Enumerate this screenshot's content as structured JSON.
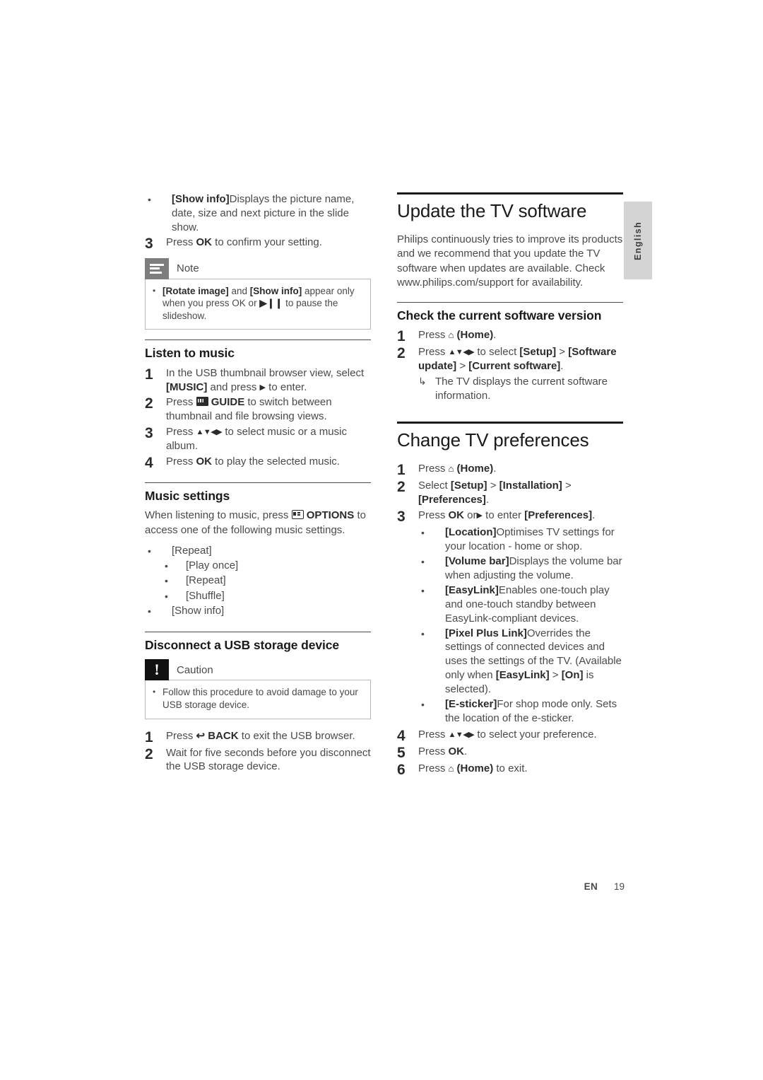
{
  "page": {
    "language_tab": "English",
    "footer_locale": "EN",
    "footer_page": "19"
  },
  "left_column": {
    "top_bullet": {
      "marker": "•",
      "label": "[Show info]",
      "text": "Displays the picture name, date, size and next picture in the slide show."
    },
    "step3": {
      "num": "3",
      "pre": "Press ",
      "key": "OK",
      "post": " to confirm your setting."
    },
    "note_box": {
      "icon": "note-lines-icon",
      "title": "Note",
      "bullet_marker": "•",
      "text_part1": "[Rotate image]",
      "text_part2": " and ",
      "text_part3": "[Show info]",
      "text_part4": " appear only when you press OK or ",
      "text_part5": "▶❙❙",
      "text_part6": " to pause the slideshow."
    },
    "listen_to_music": {
      "heading": "Listen to music",
      "steps": [
        {
          "num": "1",
          "pre": "In the USB thumbnail browser view, select ",
          "bold": "[MUSIC]",
          "mid": " and press ",
          "glyph": "▶",
          "post": " to enter."
        },
        {
          "num": "2",
          "pre": "Press ",
          "icon": "guide-key-icon",
          "bold": "GUIDE",
          "post": " to switch between thumbnail and file browsing views."
        },
        {
          "num": "3",
          "pre": "Press ",
          "arrows": "▲▼◀▶",
          "post": " to select music or a music album."
        },
        {
          "num": "4",
          "pre": "Press ",
          "bold": "OK",
          "post": " to play the selected music."
        }
      ]
    },
    "music_settings": {
      "heading": "Music settings",
      "intro_pre": "When listening to music, press ",
      "intro_icon": "options-key-icon",
      "intro_bold": "OPTIONS",
      "intro_post": " to access one of the following music settings.",
      "items": [
        {
          "marker": "•",
          "label": "[Repeat]",
          "level": 1
        },
        {
          "marker": "•",
          "label": "[Play once]",
          "level": 2
        },
        {
          "marker": "•",
          "label": "[Repeat]",
          "level": 2
        },
        {
          "marker": "•",
          "label": "[Shuffle]",
          "level": 2
        },
        {
          "marker": "•",
          "label": "[Show info]",
          "level": 1
        }
      ]
    },
    "disconnect_usb": {
      "heading": "Disconnect a USB storage device",
      "caution_box": {
        "icon": "exclamation-icon",
        "title": "Caution",
        "bullet_marker": "•",
        "text": "Follow this procedure to avoid damage to your USB storage device."
      },
      "steps": [
        {
          "num": "1",
          "pre": "Press ",
          "icon": "back-key-icon",
          "bold": "BACK",
          "post": " to exit the USB browser."
        },
        {
          "num": "2",
          "pre": "Wait for five seconds before you disconnect the USB storage device."
        }
      ]
    }
  },
  "right_column": {
    "update_software": {
      "heading": "Update the TV software",
      "paragraph": "Philips continuously tries to improve its products and we recommend that you update the TV software when updates are available. Check www.philips.com/support for availability."
    },
    "check_version": {
      "heading": "Check the current software version",
      "steps": [
        {
          "num": "1",
          "pre": "Press ",
          "home_icon": "⌂",
          "bold": "(Home)",
          "post": "."
        },
        {
          "num": "2",
          "pre": "Press ",
          "arrows": "▲▼◀▶",
          "mid1": " to select ",
          "b1": "[Setup]",
          "sep1": " > ",
          "b2": "[Software update]",
          "sep2": " > ",
          "b3": "[Current software]",
          "post": "."
        }
      ],
      "arrow_note": {
        "arrow": "↳",
        "text": "The TV displays the current software information."
      }
    },
    "change_preferences": {
      "heading": "Change TV preferences",
      "steps": [
        {
          "num": "1",
          "pre": "Press ",
          "home_icon": "⌂",
          "bold": "(Home)",
          "post": "."
        },
        {
          "num": "2",
          "pre": "Select ",
          "b1": "[Setup]",
          "sep1": " > ",
          "b2": "[Installation]",
          "sep2": " > ",
          "b3": "[Preferences]",
          "post": "."
        },
        {
          "num": "3",
          "pre": "Press ",
          "bold": "OK",
          "mid": " or",
          "glyph": "▶",
          "mid2": " to enter ",
          "b2": "[Preferences]",
          "post": "."
        }
      ],
      "preference_items": [
        {
          "marker": "•",
          "label": "[Location]",
          "text": "Optimises TV settings for your location - home or shop."
        },
        {
          "marker": "•",
          "label": "[Volume bar]",
          "text": "Displays the volume bar when adjusting the volume."
        },
        {
          "marker": "•",
          "label": "[EasyLink]",
          "text": "Enables one-touch play and one-touch standby between EasyLink-compliant devices."
        },
        {
          "marker": "•",
          "label": "[Pixel Plus Link]",
          "text_a": "Overrides the settings of connected devices and uses the settings of the TV. (Available only when ",
          "b1": "[EasyLink]",
          "sep": " > ",
          "b2": "[On]",
          "text_b": " is selected)."
        },
        {
          "marker": "•",
          "label": "[E-sticker]",
          "text": "For shop mode only. Sets the location of the e-sticker."
        }
      ],
      "final_steps": [
        {
          "num": "4",
          "pre": "Press ",
          "arrows": "▲▼◀▶",
          "post": " to select your preference."
        },
        {
          "num": "5",
          "pre": "Press ",
          "bold": "OK",
          "post": "."
        },
        {
          "num": "6",
          "pre": "Press ",
          "home_icon": "⌂",
          "bold": "(Home)",
          "post": " to exit."
        }
      ]
    }
  }
}
